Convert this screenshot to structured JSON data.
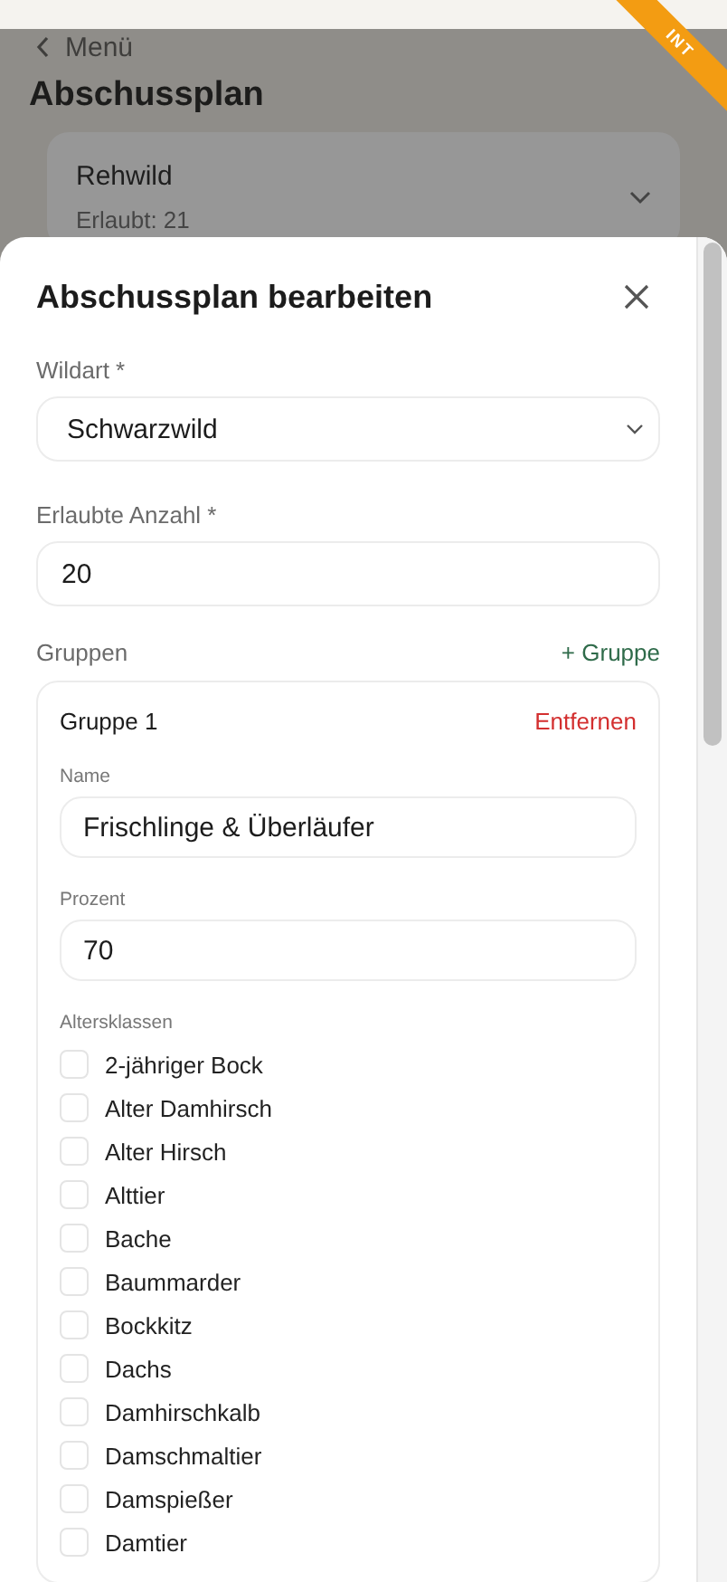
{
  "environment_badge": "INT",
  "background_page": {
    "back_link": "Menü",
    "title": "Abschussplan",
    "cards": [
      {
        "name": "Rehwild",
        "allowed": "Erlaubt: 21"
      }
    ]
  },
  "sheet": {
    "title": "Abschussplan bearbeiten",
    "species": {
      "label": "Wildart *",
      "value": "Schwarzwild"
    },
    "allowed_count": {
      "label": "Erlaubte Anzahl *",
      "value": "20"
    },
    "groups_label": "Gruppen",
    "add_group": "+ Gruppe",
    "groups": [
      {
        "title": "Gruppe 1",
        "remove": "Entfernen",
        "name": {
          "label": "Name",
          "value": "Frischlinge & Überläufer"
        },
        "percent": {
          "label": "Prozent",
          "value": "70"
        },
        "age_classes_label": "Altersklassen",
        "age_classes": [
          {
            "label": "2-jähriger Bock",
            "checked": false
          },
          {
            "label": "Alter Damhirsch",
            "checked": false
          },
          {
            "label": "Alter Hirsch",
            "checked": false
          },
          {
            "label": "Alttier",
            "checked": false
          },
          {
            "label": "Bache",
            "checked": false
          },
          {
            "label": "Baummarder",
            "checked": false
          },
          {
            "label": "Bockkitz",
            "checked": false
          },
          {
            "label": "Dachs",
            "checked": false
          },
          {
            "label": "Damhirschkalb",
            "checked": false
          },
          {
            "label": "Damschmaltier",
            "checked": false
          },
          {
            "label": "Damspießer",
            "checked": false
          },
          {
            "label": "Damtier",
            "checked": false
          }
        ]
      }
    ]
  }
}
